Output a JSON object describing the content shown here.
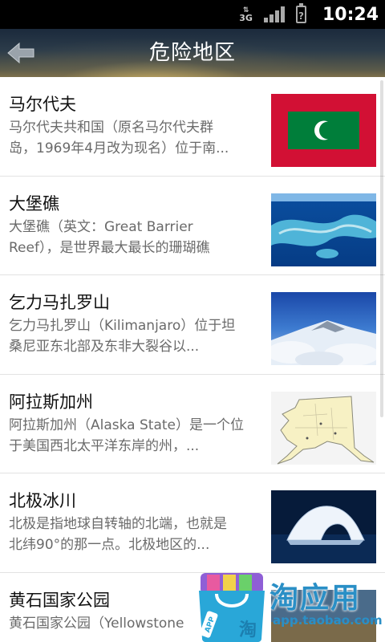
{
  "status_bar": {
    "network": "3G",
    "time": "10:24",
    "battery_glyph": "?"
  },
  "header": {
    "title": "危险地区"
  },
  "items": [
    {
      "title": "马尔代夫",
      "desc_line1": "马尔代夫共和国（原名马尔代夫群",
      "desc_line2": "岛，1969年4月改为现名）位于南...",
      "thumb": "maldives-flag"
    },
    {
      "title": "大堡礁",
      "desc_line1": "大堡礁（英文：Great Barrier",
      "desc_line2": "Reef），是世界最大最长的珊瑚礁",
      "thumb": "great-barrier-reef"
    },
    {
      "title": "乞力马扎罗山",
      "desc_line1": "乞力马扎罗山（Kilimanjaro）位于坦",
      "desc_line2": "桑尼亚东北部及东非大裂谷以...",
      "thumb": "kilimanjaro-clouds"
    },
    {
      "title": "阿拉斯加州",
      "desc_line1": "阿拉斯加州（Alaska State）是一个位",
      "desc_line2": "于美国西北太平洋东岸的州，...",
      "thumb": "alaska-map"
    },
    {
      "title": "北极冰川",
      "desc_line1": "北极是指地球自转轴的北端，也就是",
      "desc_line2": "北纬90°的那一点。北极地区的...",
      "thumb": "arctic-iceberg"
    },
    {
      "title": "黄石国家公园",
      "desc_line1": "黄石国家公园（Yellowstone",
      "desc_line2": "",
      "thumb": "yellowstone"
    }
  ],
  "watermark": {
    "brand": "淘应用",
    "url": "app.taobao.com",
    "bag_text": "淘",
    "tag_text": "APP"
  },
  "colors": {
    "title_text": "#111111",
    "desc_text": "#6a6a6a",
    "maldives_red": "#d21034",
    "maldives_green": "#007e3a",
    "watermark_blue": "#2a8fc6"
  }
}
